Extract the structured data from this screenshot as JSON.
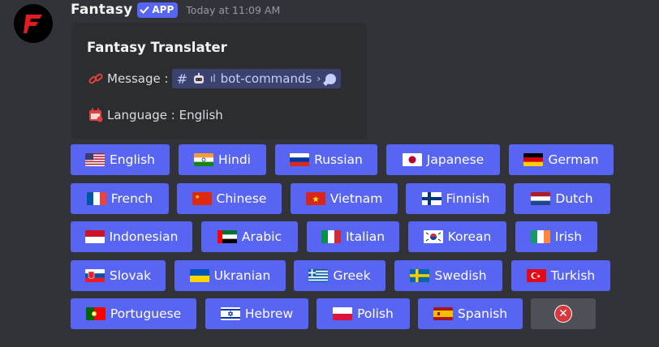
{
  "message": {
    "bot_name": "Fantasy",
    "app_badge": "APP",
    "timestamp": "Today at 11:09 AM"
  },
  "embed": {
    "title": "Fantasy Translater",
    "message_label": "Message :",
    "channel_name": "bot-commands",
    "language_label": "Language : English"
  },
  "buttons": [
    {
      "label": "English",
      "flag": "us"
    },
    {
      "label": "Hindi",
      "flag": "in"
    },
    {
      "label": "Russian",
      "flag": "ru"
    },
    {
      "label": "Japanese",
      "flag": "jp"
    },
    {
      "label": "German",
      "flag": "de"
    },
    {
      "label": "French",
      "flag": "fr"
    },
    {
      "label": "Chinese",
      "flag": "cn"
    },
    {
      "label": "Vietnam",
      "flag": "vn"
    },
    {
      "label": "Finnish",
      "flag": "fi"
    },
    {
      "label": "Dutch",
      "flag": "nl"
    },
    {
      "label": "Indonesian",
      "flag": "id"
    },
    {
      "label": "Arabic",
      "flag": "ae"
    },
    {
      "label": "Italian",
      "flag": "it"
    },
    {
      "label": "Korean",
      "flag": "kr"
    },
    {
      "label": "Irish",
      "flag": "ie"
    },
    {
      "label": "Slovak",
      "flag": "sk"
    },
    {
      "label": "Ukranian",
      "flag": "ua"
    },
    {
      "label": "Greek",
      "flag": "gr"
    },
    {
      "label": "Swedish",
      "flag": "se"
    },
    {
      "label": "Turkish",
      "flag": "tr"
    },
    {
      "label": "Portuguese",
      "flag": "pt"
    },
    {
      "label": "Hebrew",
      "flag": "il"
    },
    {
      "label": "Polish",
      "flag": "pl"
    },
    {
      "label": "Spanish",
      "flag": "es"
    }
  ],
  "colors": {
    "background": "#313338",
    "embed": "#2b2d31",
    "blurple": "#5865f2",
    "grey_button": "#4e5058",
    "danger": "#da373c"
  }
}
